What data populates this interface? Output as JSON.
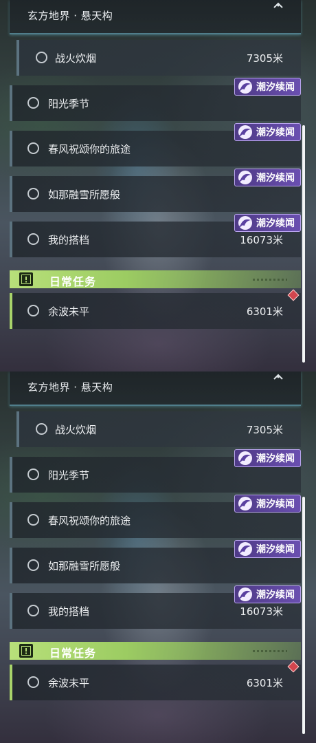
{
  "header": {
    "title": "玄方地界 · 悬天构"
  },
  "tag_label": "潮汐续闻",
  "quests": [
    {
      "label": "战火炊烟",
      "distance": "7305米",
      "tag": false
    },
    {
      "label": "阳光季节",
      "distance": "",
      "tag": true
    },
    {
      "label": "春风祝颂你的旅途",
      "distance": "",
      "tag": true
    },
    {
      "label": "如那融雪所愿般",
      "distance": "",
      "tag": true
    },
    {
      "label": "我的搭档",
      "distance": "16073米",
      "tag": true
    }
  ],
  "daily": {
    "label": "日常任务",
    "quest": {
      "label": "余波未平",
      "distance": "6301米"
    }
  },
  "colors": {
    "accent_cyan": "#78c8dc",
    "daily_green": "#a8d36a",
    "tag_purple": "#6a4fb0",
    "alert_red": "#d2454e"
  }
}
